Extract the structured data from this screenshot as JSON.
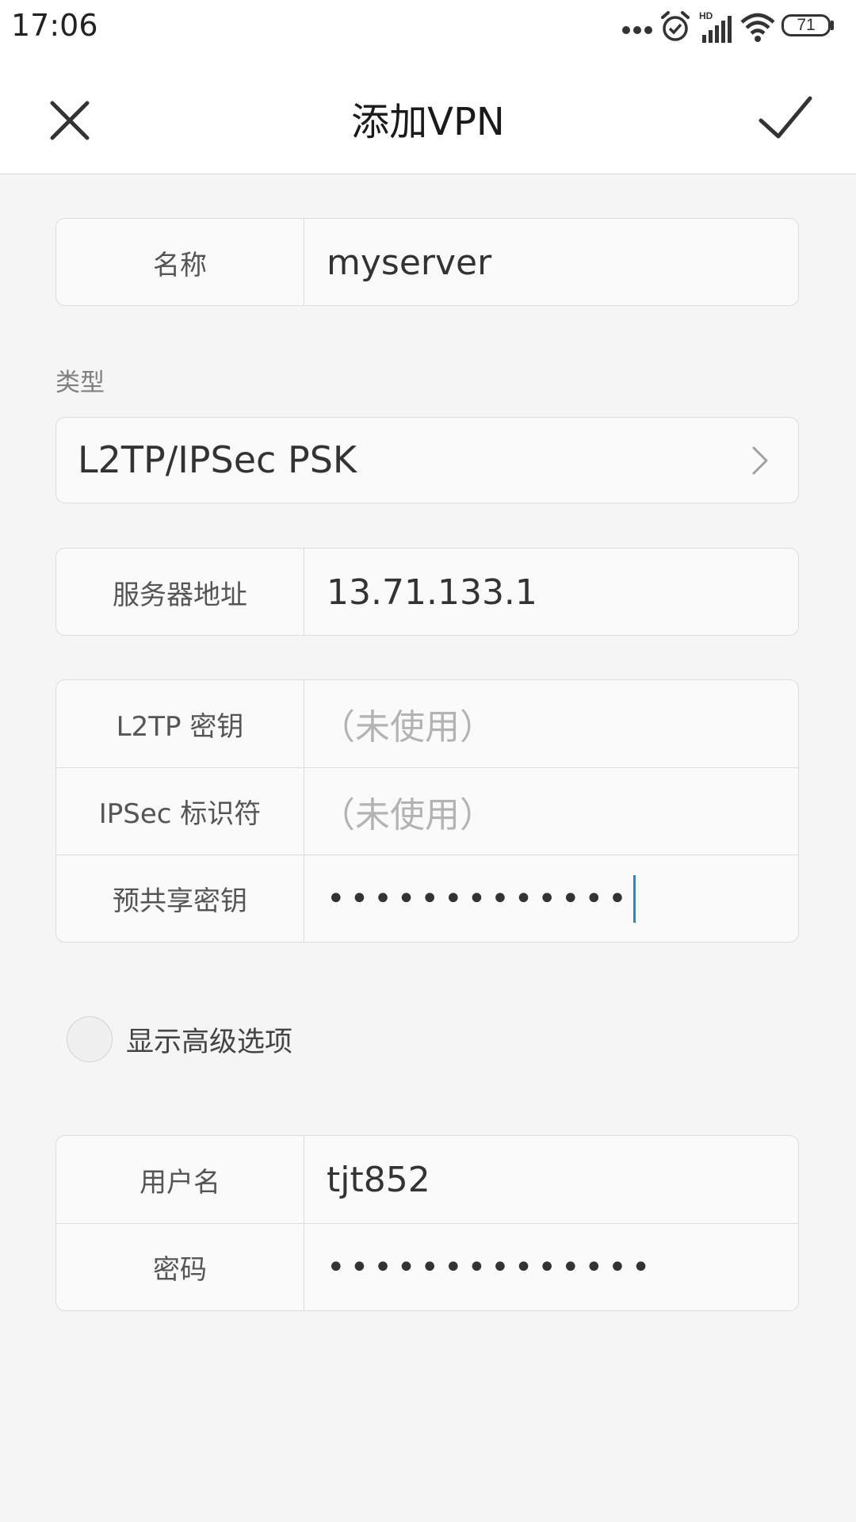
{
  "status_bar": {
    "time": "17:06",
    "battery": "71",
    "icons": [
      "more-dots-icon",
      "alarm-icon",
      "hd-signal-icon",
      "wifi-icon",
      "battery-icon"
    ]
  },
  "header": {
    "title": "添加VPN",
    "close_icon": "close-icon",
    "confirm_icon": "checkmark-icon"
  },
  "form": {
    "name": {
      "label": "名称",
      "value": "myserver"
    },
    "type": {
      "section_label": "类型",
      "value": "L2TP/IPSec PSK"
    },
    "server": {
      "label": "服务器地址",
      "value": "13.71.133.1"
    },
    "l2tp_secret": {
      "label": "L2TP 密钥",
      "placeholder": "（未使用）"
    },
    "ipsec_identifier": {
      "label": "IPSec 标识符",
      "placeholder": "（未使用）"
    },
    "preshared_key": {
      "label": "预共享密钥",
      "value": "•••••••••••••"
    },
    "advanced": {
      "label": "显示高级选项"
    },
    "username": {
      "label": "用户名",
      "value": "tjt852"
    },
    "password": {
      "label": "密码",
      "value": "••••••••••••••"
    }
  },
  "colors": {
    "background": "#f5f5f5",
    "card": "#fafafa",
    "border": "#dcdcdc",
    "cursor": "#1a8fd8",
    "placeholder": "#b3b3b3"
  }
}
